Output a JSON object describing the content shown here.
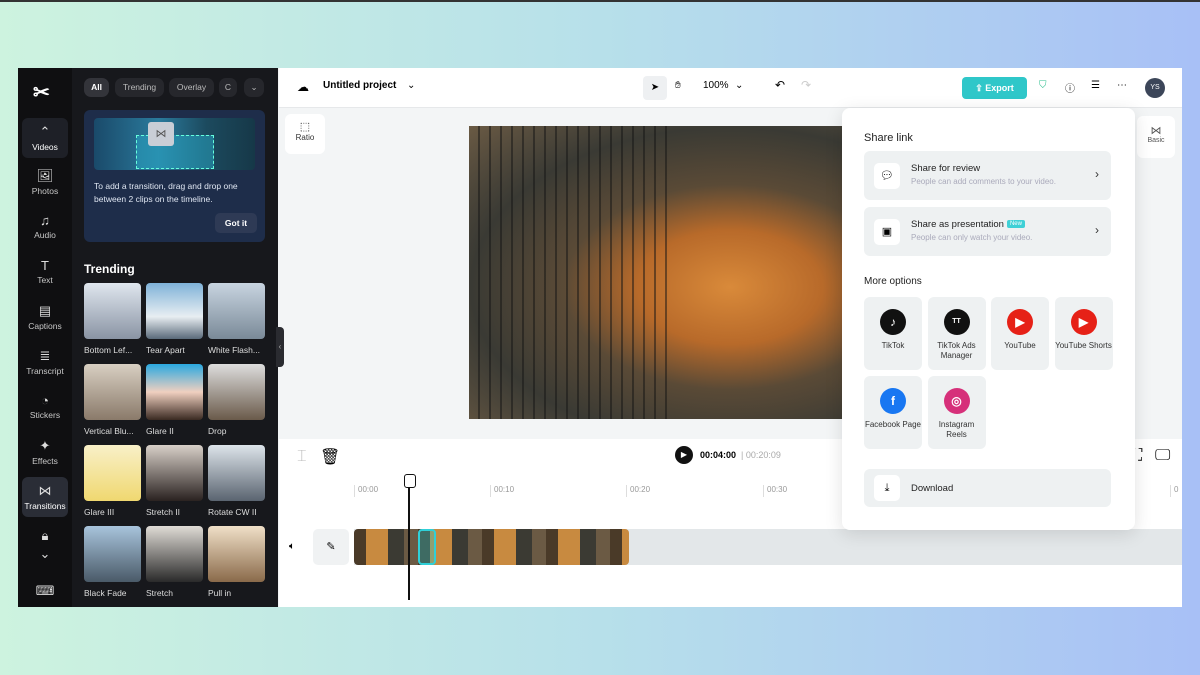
{
  "rail": {
    "items": [
      {
        "label": "Videos",
        "icon": "chevron-up-icon"
      },
      {
        "label": "Photos",
        "icon": "image-icon"
      },
      {
        "label": "Audio",
        "icon": "music-icon"
      },
      {
        "label": "Text",
        "icon": "text-icon"
      },
      {
        "label": "Captions",
        "icon": "captions-icon"
      },
      {
        "label": "Transcript",
        "icon": "transcript-icon"
      },
      {
        "label": "Stickers",
        "icon": "sticker-icon"
      },
      {
        "label": "Effects",
        "icon": "sparkle-icon"
      },
      {
        "label": "Transitions",
        "icon": "bowtie-icon"
      }
    ],
    "active": "Transitions"
  },
  "panel": {
    "filters": [
      "All",
      "Trending",
      "Overlay",
      "C"
    ],
    "tip": {
      "text": "To add a transition, drag and drop one between 2 clips on the timeline.",
      "button": "Got it"
    },
    "section": "Trending",
    "items": [
      "Bottom Lef...",
      "Tear Apart",
      "White Flash...",
      "Vertical Blu...",
      "Glare II",
      "Drop",
      "Glare III",
      "Stretch II",
      "Rotate CW II",
      "Black Fade",
      "Stretch",
      "Pull in"
    ]
  },
  "header": {
    "project": "Untitled project",
    "zoom": "100%",
    "export": "Export",
    "avatar": "YS"
  },
  "canvas": {
    "ratio": "Ratio",
    "basic": "Basic"
  },
  "timeline": {
    "current": "00:04:00",
    "total": "00:20:09",
    "ticks": [
      "00:00",
      "00:10",
      "00:20",
      "00:30",
      "0"
    ]
  },
  "share": {
    "title": "Share link",
    "review": {
      "title": "Share for review",
      "sub": "People can add comments to your video."
    },
    "presentation": {
      "title": "Share as presentation",
      "badge": "New",
      "sub": "People can only watch your video."
    },
    "more": "More options",
    "options": [
      {
        "label": "TikTok",
        "color": "#111111"
      },
      {
        "label": "TikTok Ads Manager",
        "color": "#111111"
      },
      {
        "label": "YouTube",
        "color": "#e62117"
      },
      {
        "label": "YouTube Shorts",
        "color": "#e62117"
      },
      {
        "label": "Facebook Page",
        "color": "#1877f2"
      },
      {
        "label": "Instagram Reels",
        "color": "#d6307a"
      }
    ],
    "download": "Download"
  },
  "colors": {
    "accent": "#2fc7c9"
  }
}
